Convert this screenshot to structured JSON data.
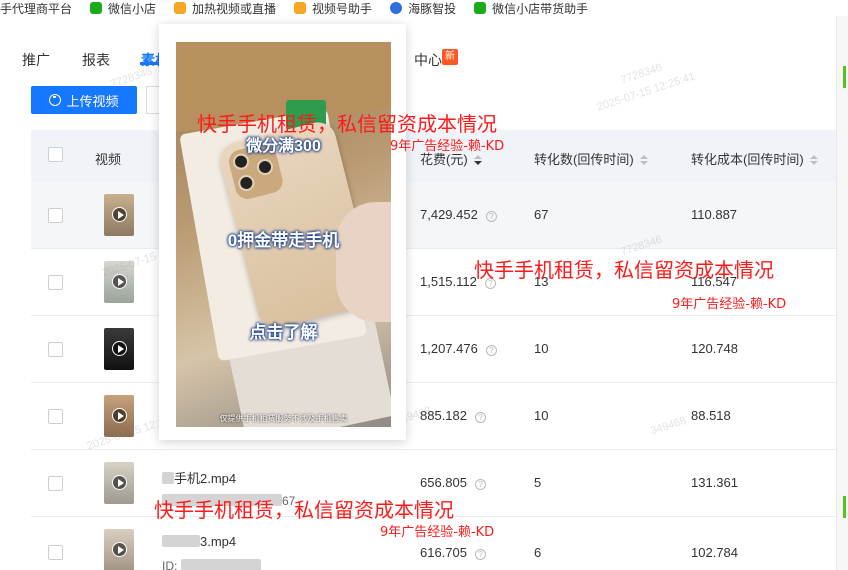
{
  "bookmarks": [
    {
      "label": "手代理商平台",
      "icon": "none",
      "color": ""
    },
    {
      "label": "微信小店",
      "icon": "wechat-shop-icon",
      "color": "#1aad19"
    },
    {
      "label": "加热视频或直播",
      "icon": "w-logo-icon",
      "color": "#f5a623"
    },
    {
      "label": "视频号助手",
      "icon": "w-logo-icon",
      "color": "#f5a623"
    },
    {
      "label": "海豚智投",
      "icon": "dolphin-icon",
      "color": "#2f6fe0"
    },
    {
      "label": "微信小店带货助手",
      "icon": "wechat-shop-icon",
      "color": "#1aad19"
    }
  ],
  "nav": {
    "items": [
      "推广",
      "报表",
      "素材"
    ],
    "center_suffix": "中心",
    "new_badge": "新"
  },
  "toolbar": {
    "upload_label": "上传视频"
  },
  "table": {
    "headers": {
      "video": "视频",
      "cost": "花费(元)",
      "conversions": "转化数(回传时间)",
      "conversion_cost": "转化成本(回传时间)"
    },
    "rows": [
      {
        "cost": "7,429.452",
        "conversions": "67",
        "conversion_cost": "110.887"
      },
      {
        "cost": "1,515.112",
        "conversions": "13",
        "conversion_cost": "116.547"
      },
      {
        "cost": "1,207.476",
        "conversions": "10",
        "conversion_cost": "120.748"
      },
      {
        "cost": "885.182",
        "conversions": "10",
        "conversion_cost": "88.518"
      },
      {
        "cost": "656.805",
        "conversions": "5",
        "conversion_cost": "131.361",
        "filename": "手机2.mp4",
        "id_tail": "67"
      },
      {
        "cost": "616.705",
        "conversions": "6",
        "conversion_cost": "102.784",
        "filename": "3.mp4",
        "id_label": "ID:"
      }
    ]
  },
  "preview": {
    "overlay_1": "微分满300",
    "overlay_2": "0押金带走手机",
    "overlay_3": "点击了解",
    "caption": "仅提供手机租赁服务不涉及手机售卖"
  },
  "watermark": {
    "id": "7728346",
    "id_b": "349468",
    "time": "2025-07-15 12:25:41"
  },
  "annotations": {
    "headline": "快手手机租赁，私信留资成本情况",
    "tagline": "9年广告经验-赖-KD"
  },
  "colors": {
    "primary": "#1677ff",
    "annotation": "#ff1a1a",
    "new_badge": "#ff5722"
  }
}
